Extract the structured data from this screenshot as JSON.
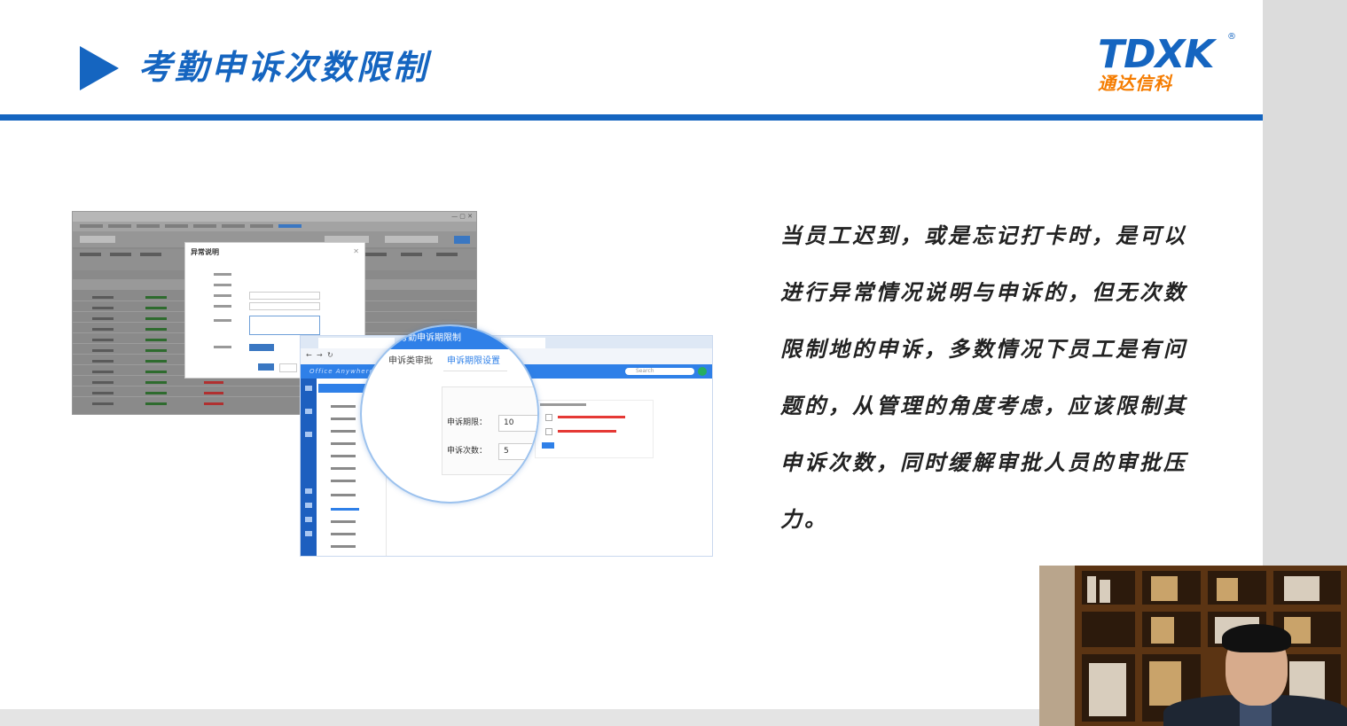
{
  "slide": {
    "title": "考勤申诉次数限制",
    "logo": {
      "mark": "TDXK",
      "registered": "®",
      "chinese": "通达信科"
    },
    "description": "当员工迟到，或是忘记打卡时，是可以进行异常情况说明与申诉的，但无次数限制地的申诉，多数情况下员工是有问题的，从管理的角度考虑，应该限制其申诉次数，同时缓解审批人员的审批压力。"
  },
  "screenshot_a": {
    "window_buttons": "— ▢ ✕",
    "modal_title": "异常说明",
    "modal_close": "✕"
  },
  "screenshot_b": {
    "app_name": "Office Anywhere",
    "search_placeholder": "Search"
  },
  "zoom": {
    "header_title": "考勤申诉期限制",
    "tab_approval": "申诉类审批",
    "tab_limit_settings": "申诉期限设置",
    "period_label": "申诉期限：",
    "period_value": "10",
    "count_label": "申诉次数：",
    "count_value": "5"
  },
  "colors": {
    "brand_blue": "#1565c0",
    "logo_orange": "#f57c00",
    "app_blue": "#2f80e8"
  }
}
